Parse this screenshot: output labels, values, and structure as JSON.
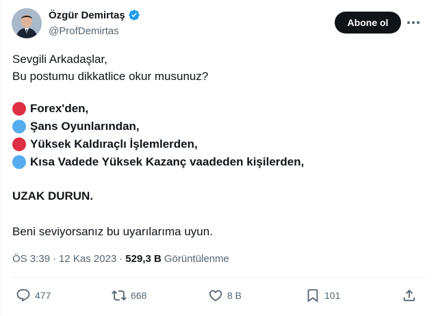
{
  "author": {
    "display_name": "Özgür Demirtaş",
    "handle": "@ProfDemirtas",
    "verified": true
  },
  "header": {
    "follow_label": "Abone ol",
    "more_icon": "more-horizontal-icon"
  },
  "tweet": {
    "line1": "Sevgili Arkadaşlar,",
    "line2": "Bu postumu dikkatlice okur musunuz?",
    "items": [
      {
        "text": "Forex'den,",
        "color": "#dd2e44"
      },
      {
        "text": "Şans Oyunlarından,",
        "color": "#55acee"
      },
      {
        "text": "Yüksek Kaldıraçlı İşlemlerden,",
        "color": "#dd2e44"
      },
      {
        "text": "Kısa Vadede Yüksek Kazanç vaadeden kişilerden,",
        "color": "#55acee"
      }
    ],
    "warning": "UZAK DURUN.",
    "closing": "Beni seviyorsanız bu uyarılarıma uyun."
  },
  "meta": {
    "time": "ÖS 3:39",
    "separator": "·",
    "date": "12 Kas 2023",
    "views_count": "529,3 B",
    "views_label": "Görüntülenme"
  },
  "actions": {
    "replies": "477",
    "reposts": "668",
    "likes": "8 B",
    "bookmarks": "101"
  },
  "colors": {
    "text": "#0f1419",
    "secondary": "#536471",
    "verified": "#1d9bf0",
    "button": "#0f1419"
  }
}
